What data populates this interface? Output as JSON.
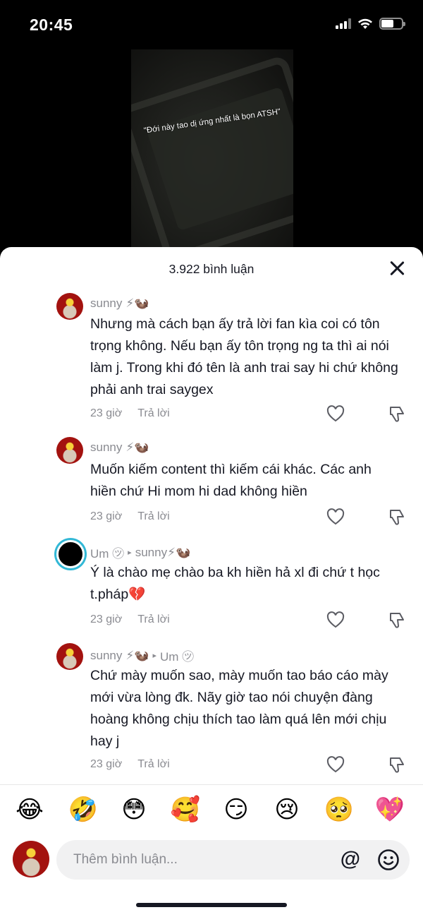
{
  "status_bar": {
    "time": "20:45"
  },
  "video": {
    "caption": "\"Đới này tao dị ứng nhất là bọn ATSH\""
  },
  "sheet": {
    "comment_count_label": "3.922 bình luận"
  },
  "comments": [
    {
      "username": "sunny",
      "username_emoji": "⚡🦦",
      "reply_to": "",
      "text": "Nhưng mà cách bạn ấy trả lời fan kìa coi có tôn trọng không. Nếu bạn ấy tôn trọng ng ta thì ai nói làm j. Trong khi đó tên là anh trai say hi chứ không phải anh trai saygex",
      "time": "23 giờ",
      "reply_label": "Trả lời"
    },
    {
      "username": "sunny",
      "username_emoji": "⚡🦦",
      "reply_to": "",
      "text": "Muốn kiếm content thì kiếm cái khác. Các anh hiền chứ Hi mom hi dad không hiền",
      "time": "23 giờ",
      "reply_label": "Trả lời"
    },
    {
      "username": "Um ㋡",
      "username_emoji": "",
      "reply_to": "sunny⚡🦦",
      "text": "Ý là chào mẹ chào ba kh hiền hả xl đi chứ t học t.pháp💔",
      "time": "23 giờ",
      "reply_label": "Trả lời"
    },
    {
      "username": "sunny",
      "username_emoji": "⚡🦦",
      "reply_to": "Um ㋡",
      "text": "Chứ mày muốn sao, mày muốn tao báo cáo mày mới vừa lòng đk. Nãy giờ tao nói chuyện đàng hoàng không chịu thích tao làm quá lên mới chịu hay j",
      "time": "23 giờ",
      "reply_label": "Trả lời"
    }
  ],
  "emoji_bar": [
    "😂",
    "🤣",
    "😳",
    "🥰",
    "😏",
    "😢",
    "🥺",
    "💖"
  ],
  "composer": {
    "placeholder": "Thêm bình luận...",
    "at_symbol": "@"
  },
  "icons": [
    "close-icon",
    "heart-icon",
    "dislike-icon",
    "at-icon",
    "emoji-icon"
  ]
}
